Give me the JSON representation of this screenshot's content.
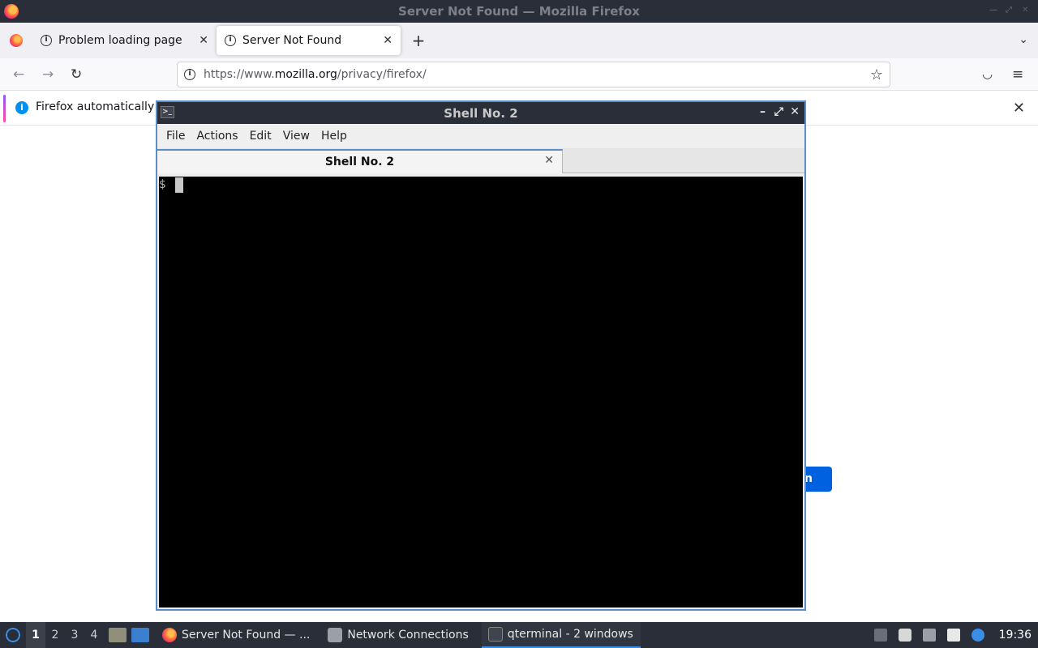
{
  "firefox": {
    "window_title": "Server Not Found — Mozilla Firefox",
    "tabs": [
      {
        "label": "Problem loading page",
        "active": false
      },
      {
        "label": "Server Not Found",
        "active": true
      }
    ],
    "url": {
      "prefix": "https://www.",
      "host": "mozilla.org",
      "path": "/privacy/firefox/"
    },
    "notification": "Firefox automatically s",
    "page_button_label": "n"
  },
  "terminal": {
    "window_title": "Shell No. 2",
    "menu": [
      "File",
      "Actions",
      "Edit",
      "View",
      "Help"
    ],
    "tab_label": "Shell No. 2",
    "prompt": "$"
  },
  "taskbar": {
    "workspaces": [
      "1",
      "2",
      "3",
      "4"
    ],
    "tasks": [
      {
        "label": "Server Not Found — ...",
        "icon": "firefox-icon",
        "active": false
      },
      {
        "label": "Network Connections",
        "icon": "network-icon",
        "active": false
      },
      {
        "label": "qterminal - 2 windows",
        "icon": "terminal-icon",
        "active": true
      }
    ],
    "clock": "19:36"
  },
  "colors": {
    "accent": "#3a8ee6",
    "firefox_button": "#0061e0",
    "panel": "#2a2e38"
  }
}
